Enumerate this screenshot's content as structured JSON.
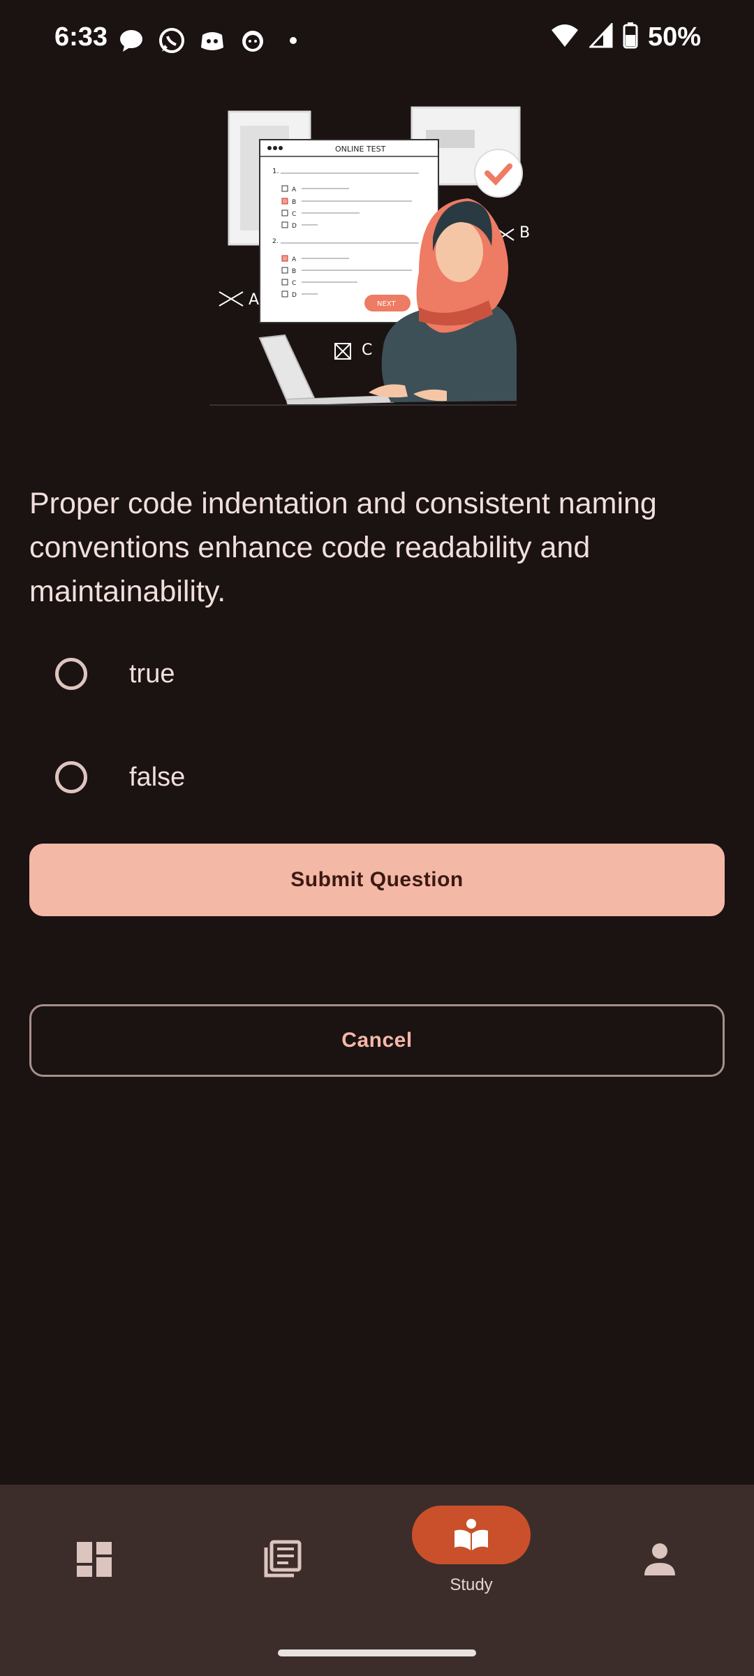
{
  "status_bar": {
    "time": "6:33",
    "battery": "50%",
    "notification_icons": [
      "message-icon",
      "whatsapp-icon",
      "discord-icon",
      "cat-app-icon",
      "dot-icon"
    ],
    "system_icons": [
      "wifi-icon",
      "signal-icon",
      "battery-icon"
    ]
  },
  "illustration": {
    "header": "ONLINE TEST",
    "next_label": "NEXT",
    "options_q1": [
      "A",
      "B",
      "C",
      "D"
    ],
    "options_q2": [
      "A",
      "B",
      "C",
      "D"
    ],
    "floating_letters": [
      "A",
      "B",
      "C"
    ]
  },
  "question": {
    "text": "Proper code indentation and consistent naming conventions enhance code readability and maintainability.",
    "options": [
      {
        "label": "true",
        "selected": false
      },
      {
        "label": "false",
        "selected": false
      }
    ]
  },
  "actions": {
    "submit_label": "Submit Question",
    "cancel_label": "Cancel"
  },
  "bottom_nav": {
    "items": [
      {
        "name": "dashboard",
        "icon": "dashboard-icon",
        "label": ""
      },
      {
        "name": "library",
        "icon": "library-icon",
        "label": ""
      },
      {
        "name": "study",
        "icon": "study-icon",
        "label": "Study",
        "active": true
      },
      {
        "name": "profile",
        "icon": "person-icon",
        "label": ""
      }
    ]
  },
  "colors": {
    "background": "#1b1212",
    "primary": "#f4b8a6",
    "accent": "#c9502a",
    "nav_bg": "#3c2d2b"
  }
}
